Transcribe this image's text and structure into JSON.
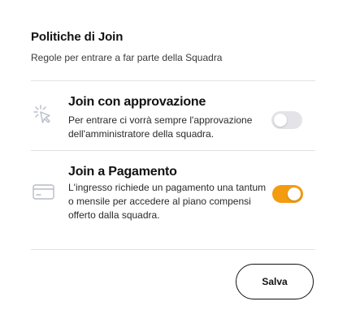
{
  "header": {
    "title": "Politiche di Join",
    "subtitle": "Regole per entrare a far parte della Squadra"
  },
  "options": [
    {
      "title": "Join con approvazione",
      "description": "Per entrare ci vorrà sempre l'approvazione dell'amministratore della squadra.",
      "icon": "cursor-click-icon",
      "enabled": false
    },
    {
      "title": "Join a Pagamento",
      "description": "L'ingresso richiede un pagamento una tantum o mensile per accedere al piano compensi offerto dalla squadra.",
      "icon": "credit-card-icon",
      "enabled": true
    }
  ],
  "actions": {
    "save_label": "Salva"
  },
  "colors": {
    "toggle_on": "#f39c12",
    "toggle_off": "#e4e4e8",
    "divider": "#e2e2e2"
  }
}
